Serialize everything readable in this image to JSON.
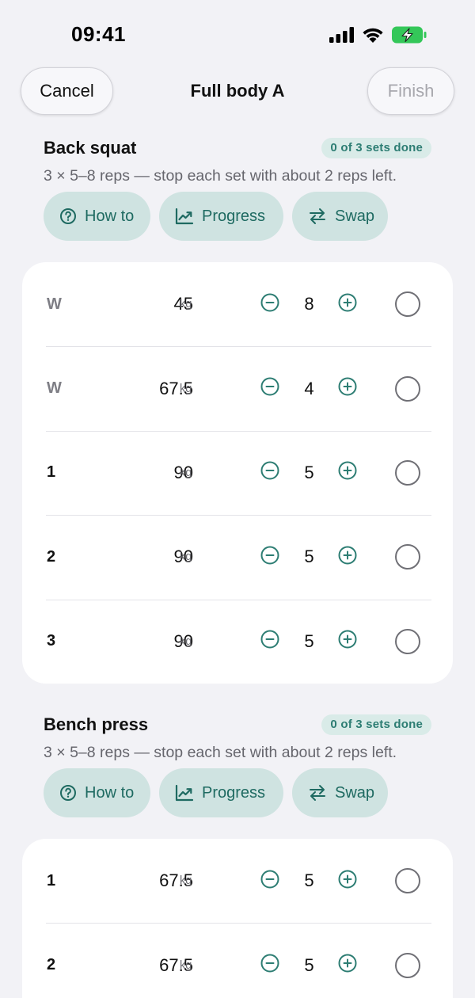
{
  "status_bar": {
    "time": "09:41",
    "icons": [
      "cellular-signal-icon",
      "wifi-icon",
      "battery-charging-icon"
    ],
    "battery_color": "#34c759"
  },
  "nav": {
    "cancel_label": "Cancel",
    "title": "Full body A",
    "finish_label": "Finish"
  },
  "colors": {
    "accent": "#2d7d73",
    "pill_bg": "#cfe3e1",
    "badge_bg": "#d9ebe8",
    "background": "#f2f2f6"
  },
  "exercises": [
    {
      "name": "Back squat",
      "badge": "0 of 3 sets done",
      "description": "3 × 5–8 reps — stop each set with about 2 reps left.",
      "actions": {
        "how_to": "How to",
        "progress": "Progress",
        "swap": "Swap"
      },
      "sets": [
        {
          "label": "W",
          "type": "warmup",
          "weight": "45",
          "unit": "kg",
          "reps": "8",
          "done": false
        },
        {
          "label": "W",
          "type": "warmup",
          "weight": "67.5",
          "unit": "kg",
          "reps": "4",
          "done": false
        },
        {
          "label": "1",
          "type": "working",
          "weight": "90",
          "unit": "kg",
          "reps": "5",
          "done": false
        },
        {
          "label": "2",
          "type": "working",
          "weight": "90",
          "unit": "kg",
          "reps": "5",
          "done": false
        },
        {
          "label": "3",
          "type": "working",
          "weight": "90",
          "unit": "kg",
          "reps": "5",
          "done": false
        }
      ]
    },
    {
      "name": "Bench press",
      "badge": "0 of 3 sets done",
      "description": "3 × 5–8 reps — stop each set with about 2 reps left.",
      "actions": {
        "how_to": "How to",
        "progress": "Progress",
        "swap": "Swap"
      },
      "sets": [
        {
          "label": "1",
          "type": "working",
          "weight": "67.5",
          "unit": "kg",
          "reps": "5",
          "done": false
        },
        {
          "label": "2",
          "type": "working",
          "weight": "67.5",
          "unit": "kg",
          "reps": "5",
          "done": false
        }
      ]
    }
  ]
}
